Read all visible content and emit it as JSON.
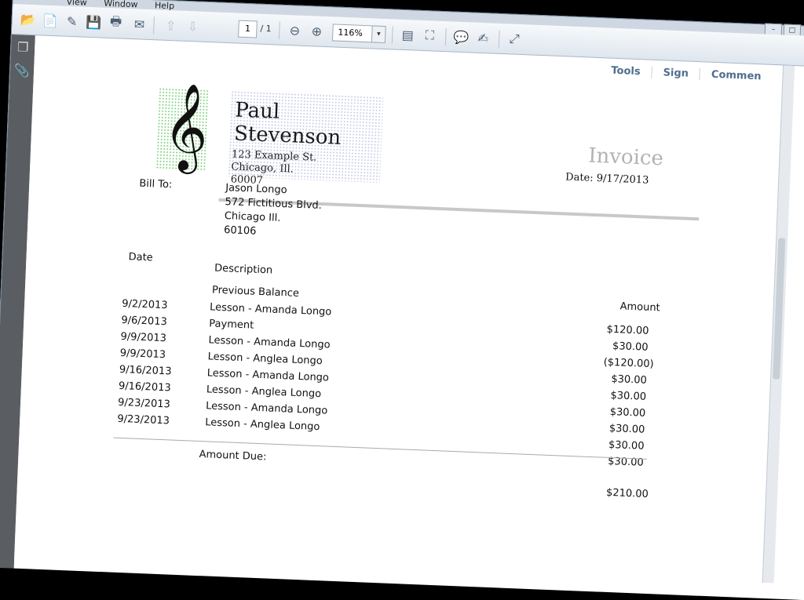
{
  "menu": {
    "items": [
      "View",
      "Window",
      "Help"
    ]
  },
  "toolbar": {
    "current_page": "1",
    "page_total": "/ 1",
    "zoom": "116%",
    "zoom_dropdown": "▾"
  },
  "icons": {
    "open": "open-file-icon",
    "create": "create-pdf-icon",
    "edit": "edit-icon",
    "save": "save-icon",
    "print": "print-icon",
    "email": "email-icon",
    "prev_page": "prev-page-icon",
    "next_page": "next-page-icon",
    "zoom_out": "zoom-out-icon",
    "zoom_in": "zoom-in-icon",
    "fit_page": "fit-page-icon",
    "fit_width": "fit-width-icon",
    "comment": "comment-icon",
    "highlight": "highlight-icon",
    "fullscreen": "fullscreen-icon",
    "pages_panel": "pages-panel-icon",
    "attachments_panel": "attachment-icon"
  },
  "panels": {
    "tools": "Tools",
    "sign": "Sign",
    "comment": "Commen"
  },
  "invoice": {
    "sender_name": "Paul Stevenson",
    "sender_address": [
      "123 Example St.",
      "Chicago, Ill.",
      "60007"
    ],
    "title": "Invoice",
    "date_line": "Date: 9/17/2013",
    "bill_to_label": "Bill To:",
    "bill_to": [
      "Jason Longo",
      "572 Fictitious Blvd.",
      "Chicago Ill.",
      "60106"
    ],
    "headers": {
      "date": "Date",
      "description": "Description",
      "amount": "Amount"
    },
    "previous_balance_label": "Previous Balance",
    "rows": [
      {
        "date": "9/2/2013",
        "description": "Lesson - Amanda Longo"
      },
      {
        "date": "9/6/2013",
        "description": "Payment"
      },
      {
        "date": "9/9/2013",
        "description": "Lesson - Amanda Longo"
      },
      {
        "date": "9/9/2013",
        "description": "Lesson - Anglea Longo"
      },
      {
        "date": "9/16/2013",
        "description": "Lesson - Amanda Longo"
      },
      {
        "date": "9/16/2013",
        "description": "Lesson - Anglea Longo"
      },
      {
        "date": "9/23/2013",
        "description": "Lesson - Amanda Longo"
      },
      {
        "date": "9/23/2013",
        "description": "Lesson - Anglea Longo"
      }
    ],
    "amounts": [
      "$120.00",
      "$30.00",
      "($120.00)",
      "$30.00",
      "$30.00",
      "$30.00",
      "$30.00",
      "$30.00",
      "$30.00"
    ],
    "amount_due_label": "Amount Due:",
    "amount_due_value": "$210.00"
  }
}
